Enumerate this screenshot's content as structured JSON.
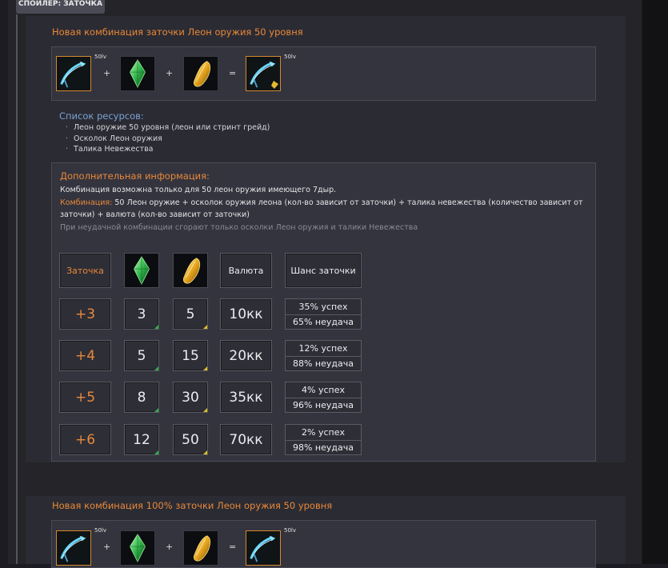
{
  "spoiler": {
    "label": "СПОЙЛЕР: ЗАТОЧКА"
  },
  "section1": {
    "title": "Новая комбинация заточки Леон оружия 50 уровня",
    "level_tag": "50lv",
    "plus": "+",
    "equals": "=",
    "resources_title": "Список ресурсов:",
    "resources": [
      "Леон оружие 50 уровня (леон или стринт грейд)",
      "Осколок Леон оружия",
      "Талика Невежества"
    ],
    "info": {
      "title": "Дополнительная информация:",
      "line1": "Комбинация возможна только для 50 леон оружия имеющего 7дыр.",
      "combo_label": "Комбинация:",
      "combo_text_a": " 50 Леон оружие + осколок оружия леона (кол-во зависит от заточки) + талика невежества (количество зависит от",
      "combo_text_b": "заточки) + валюта (кол-во зависит от заточки)",
      "fail_note": "При неудачной комбинации сгорают только осколки Леон оружия и талики Невежества"
    },
    "table": {
      "headers": {
        "level": "Заточка",
        "currency": "Валюта",
        "chance": "Шанс заточки"
      },
      "rows": [
        {
          "level": "+3",
          "shards": "3",
          "talics": "5",
          "currency": "10кк",
          "success": "35% успех",
          "fail": "65% неудача"
        },
        {
          "level": "+4",
          "shards": "5",
          "talics": "15",
          "currency": "20кк",
          "success": "12% успех",
          "fail": "88% неудача"
        },
        {
          "level": "+5",
          "shards": "8",
          "talics": "30",
          "currency": "35кк",
          "success": "4% успех",
          "fail": "96% неудача"
        },
        {
          "level": "+6",
          "shards": "12",
          "talics": "50",
          "currency": "70кк",
          "success": "2% успех",
          "fail": "98% неудача"
        }
      ]
    }
  },
  "section2": {
    "title": "Новая комбинация 100% заточки Леон оружия 50 уровня",
    "level_tag": "50lv",
    "plus": "+",
    "equals": "="
  },
  "colors": {
    "accent": "#e8893a",
    "link_blue": "#7aa2d4",
    "panel": "#2b2b33"
  }
}
